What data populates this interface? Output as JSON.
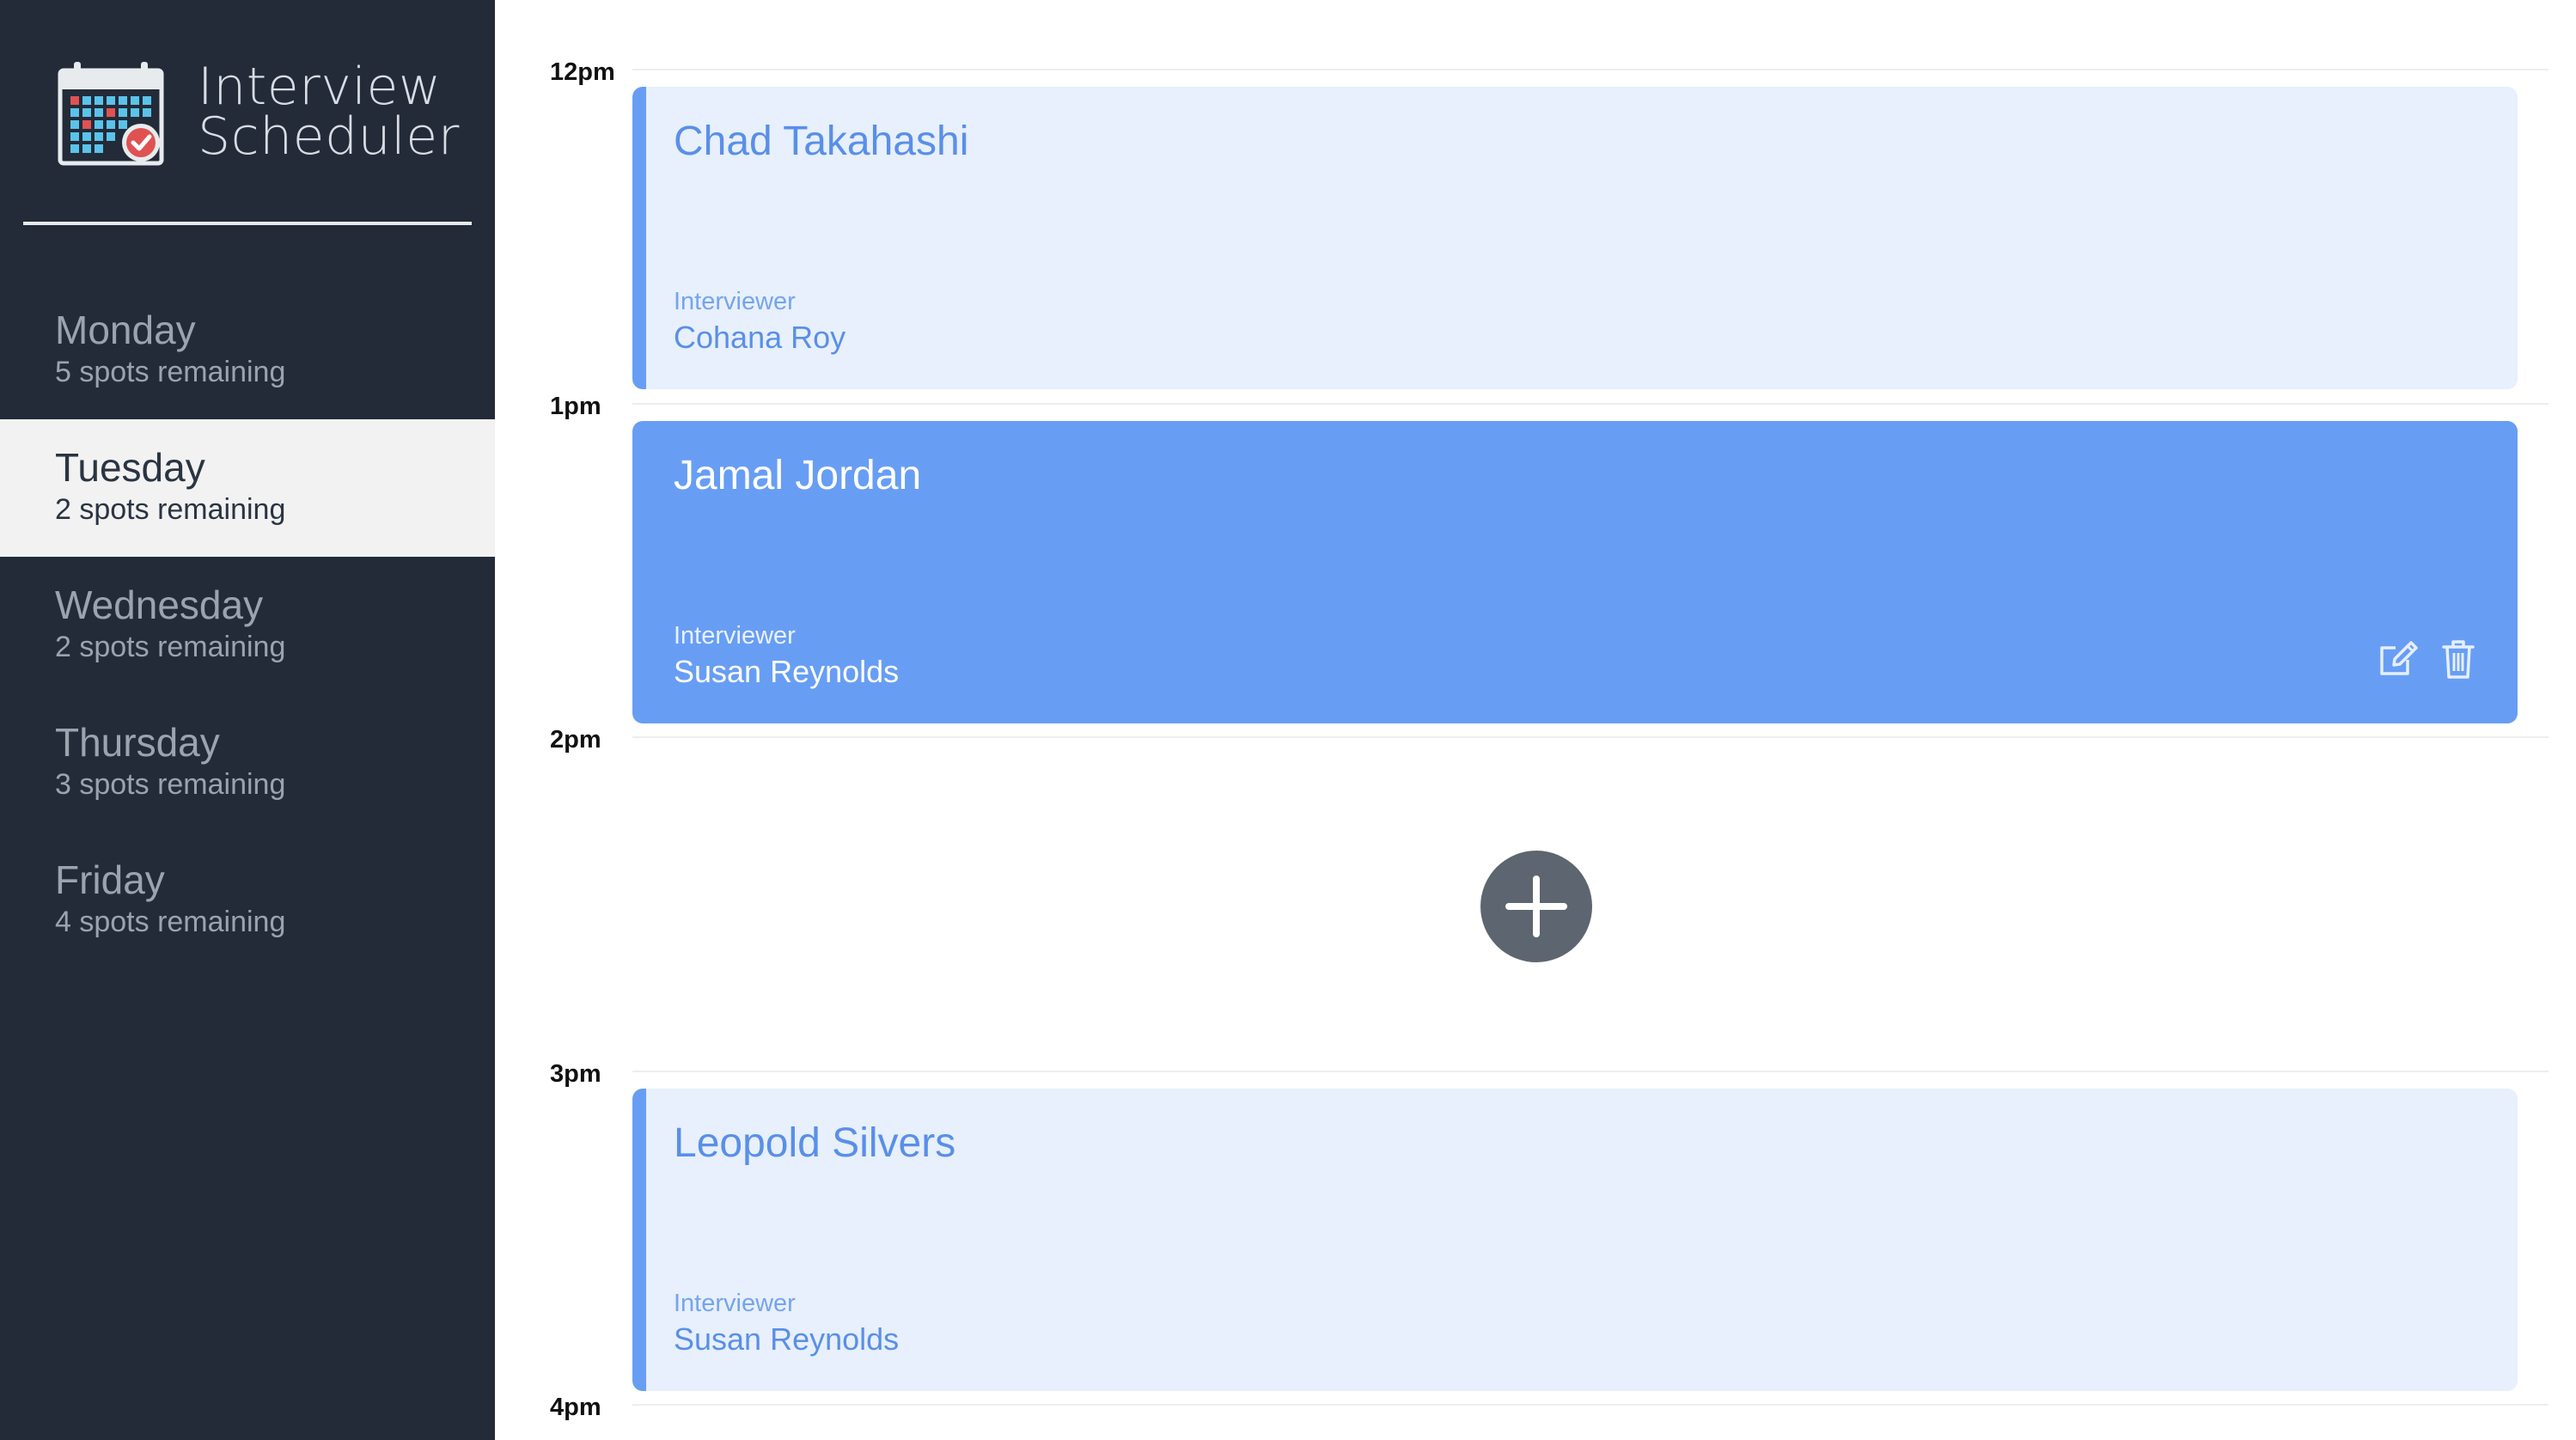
{
  "app": {
    "title_line1": "Interview",
    "title_line2": "Scheduler",
    "logo_icon": "calendar-check-icon"
  },
  "sidebar": {
    "days": [
      {
        "name": "Monday",
        "spots": "5 spots remaining",
        "selected": false
      },
      {
        "name": "Tuesday",
        "spots": "2 spots remaining",
        "selected": true
      },
      {
        "name": "Wednesday",
        "spots": "2 spots remaining",
        "selected": false
      },
      {
        "name": "Thursday",
        "spots": "3 spots remaining",
        "selected": false
      },
      {
        "name": "Friday",
        "spots": "4 spots remaining",
        "selected": false
      }
    ]
  },
  "schedule": {
    "hours": [
      "12pm",
      "1pm",
      "2pm",
      "3pm",
      "4pm"
    ],
    "appointments": [
      {
        "time": "12pm",
        "student": "Chad Takahashi",
        "interviewer_label": "Interviewer",
        "interviewer": "Cohana Roy",
        "highlighted": false
      },
      {
        "time": "1pm",
        "student": "Jamal Jordan",
        "interviewer_label": "Interviewer",
        "interviewer": "Susan Reynolds",
        "highlighted": true,
        "actions": [
          "edit-icon",
          "trash-icon"
        ]
      },
      {
        "time": "2pm",
        "empty": true,
        "action_icon": "plus-icon"
      },
      {
        "time": "3pm",
        "student": "Leopold Silvers",
        "interviewer_label": "Interviewer",
        "interviewer": "Susan Reynolds",
        "highlighted": false
      }
    ]
  },
  "colors": {
    "sidebar_bg": "#232b39",
    "selected_day_bg": "#f2f2f2",
    "accent_blue": "#679ef4",
    "light_card_bg": "#e7f0fc",
    "add_button_bg": "#5d6570"
  }
}
